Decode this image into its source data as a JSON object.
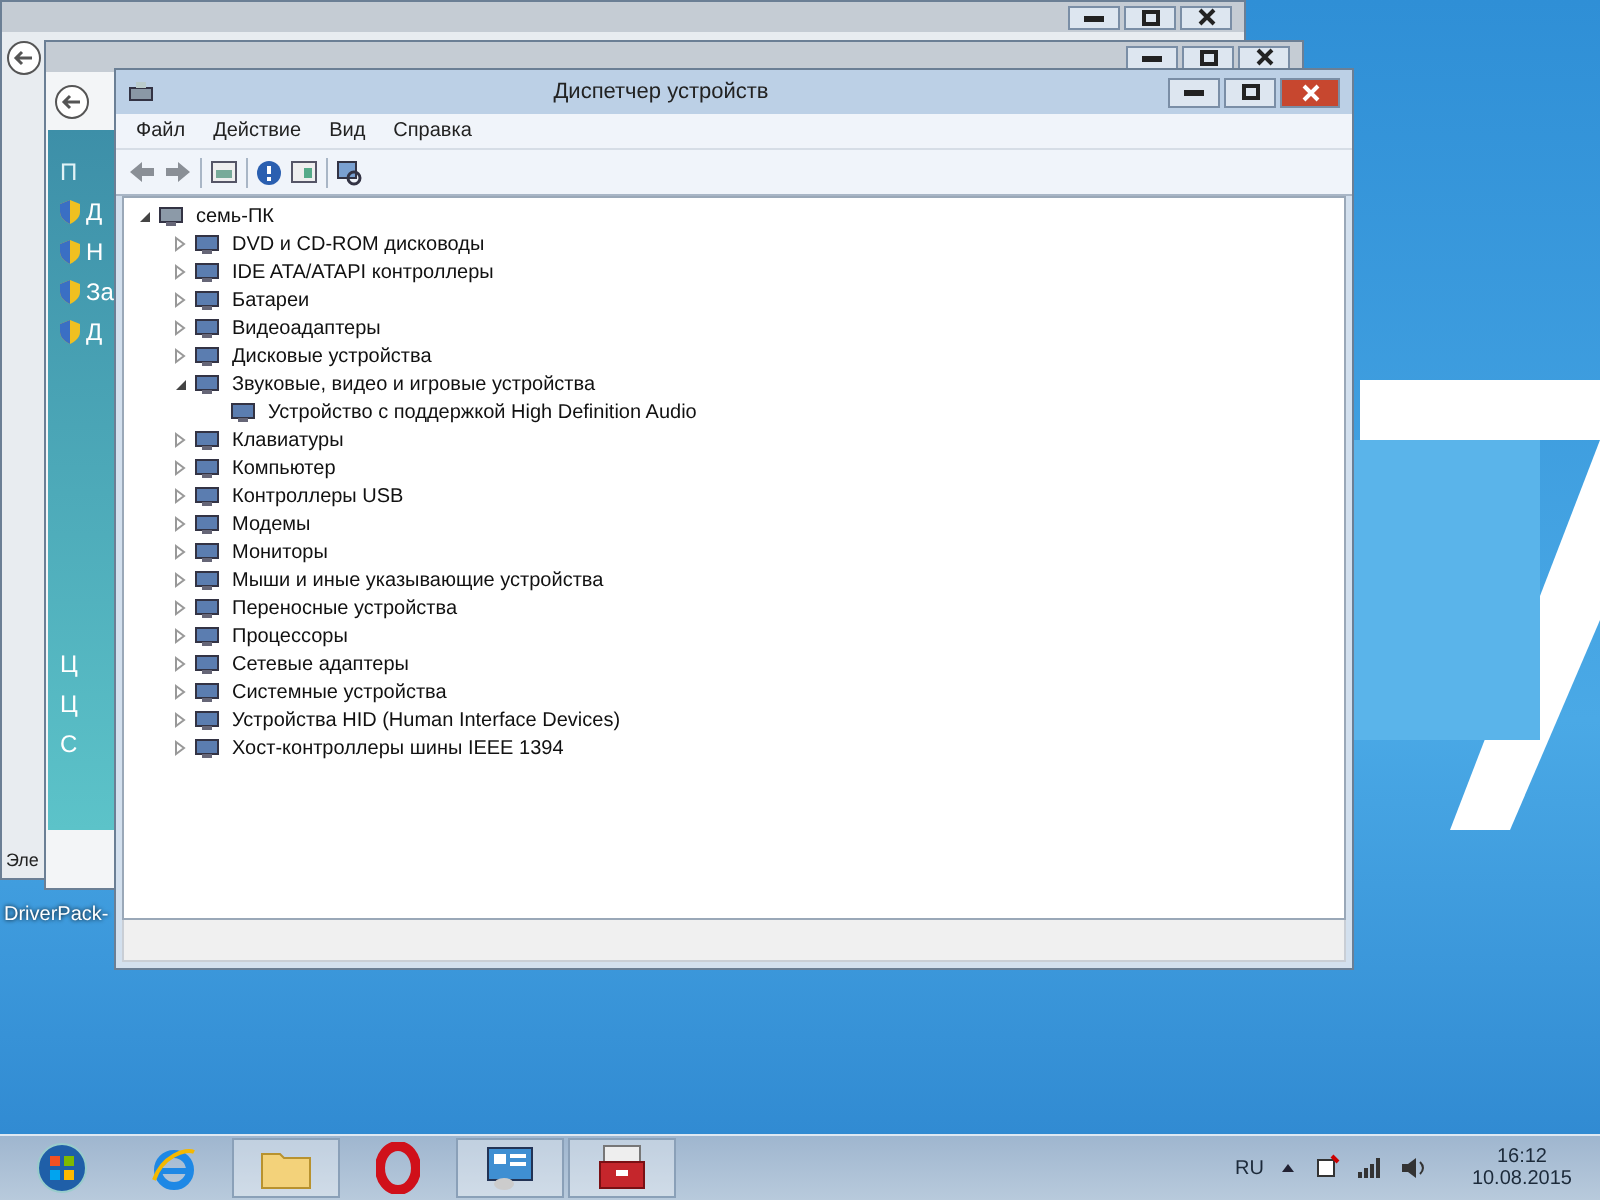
{
  "back_window_1": {
    "footer_text": "Эле"
  },
  "back_window_2": {
    "heading": "П",
    "links": [
      "Д",
      "Н",
      "За",
      "Д"
    ],
    "bottom_links": [
      "Ц",
      "Ц",
      "С"
    ]
  },
  "desktop_icon": {
    "label": "DriverPack-"
  },
  "window": {
    "title": "Диспетчер устройств"
  },
  "menu": [
    "Файл",
    "Действие",
    "Вид",
    "Справка"
  ],
  "tree": {
    "label": "семь-ПК",
    "expanded": true,
    "children": [
      {
        "label": "DVD и CD-ROM дисководы",
        "expanded": false
      },
      {
        "label": "IDE ATA/ATAPI контроллеры",
        "expanded": false
      },
      {
        "label": "Батареи",
        "expanded": false
      },
      {
        "label": "Видеоадаптеры",
        "expanded": false
      },
      {
        "label": "Дисковые устройства",
        "expanded": false
      },
      {
        "label": "Звуковые, видео и игровые устройства",
        "expanded": true,
        "children": [
          {
            "label": "Устройство с поддержкой High Definition Audio"
          }
        ]
      },
      {
        "label": "Клавиатуры",
        "expanded": false
      },
      {
        "label": "Компьютер",
        "expanded": false
      },
      {
        "label": "Контроллеры USB",
        "expanded": false
      },
      {
        "label": "Модемы",
        "expanded": false
      },
      {
        "label": "Мониторы",
        "expanded": false
      },
      {
        "label": "Мыши и иные указывающие устройства",
        "expanded": false
      },
      {
        "label": "Переносные устройства",
        "expanded": false
      },
      {
        "label": "Процессоры",
        "expanded": false
      },
      {
        "label": "Сетевые адаптеры",
        "expanded": false
      },
      {
        "label": "Системные устройства",
        "expanded": false
      },
      {
        "label": "Устройства HID (Human Interface Devices)",
        "expanded": false
      },
      {
        "label": "Хост-контроллеры шины IEEE 1394",
        "expanded": false
      }
    ]
  },
  "taskbar": {
    "apps": [
      {
        "kind": "start",
        "running": false
      },
      {
        "kind": "browser",
        "running": false
      },
      {
        "kind": "folder",
        "running": true
      },
      {
        "kind": "opera",
        "running": false
      },
      {
        "kind": "panel",
        "running": true
      },
      {
        "kind": "toolbox",
        "running": true
      }
    ],
    "language": "RU",
    "time": "16:12",
    "date": "10.08.2015"
  }
}
